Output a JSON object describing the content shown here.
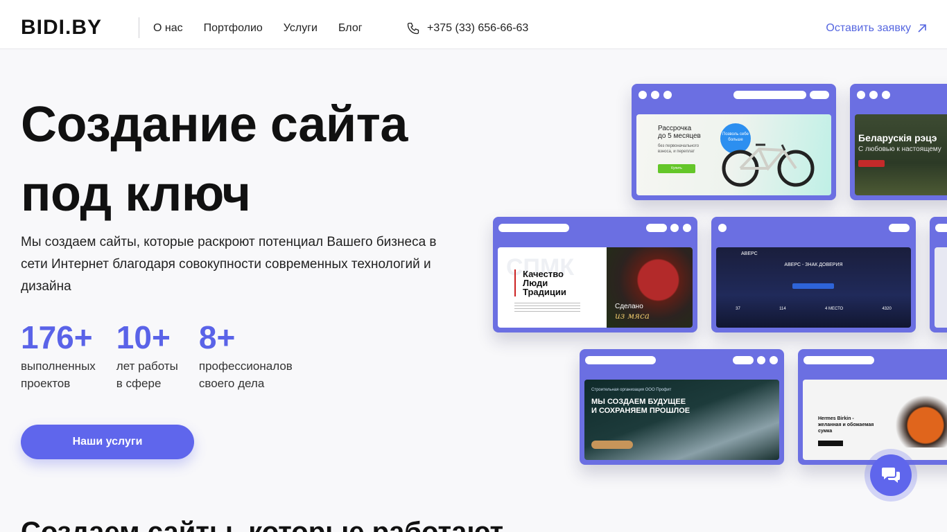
{
  "header": {
    "logo": "BIDI.BY",
    "nav": [
      {
        "label": "О нас"
      },
      {
        "label": "Портфолио"
      },
      {
        "label": "Услуги"
      },
      {
        "label": "Блог"
      }
    ],
    "phone": "+375 (33) 656-66-63",
    "cta": "Оставить заявку"
  },
  "hero": {
    "title_line1": "Создание сайта",
    "title_line2": "под ключ",
    "description": "Мы создаем сайты, которые раскроют потенциал Вашего бизнеса в сети Интернет благодаря совокупности современных технологий и дизайна",
    "stats": [
      {
        "value": "176+",
        "label_1": "выполненных",
        "label_2": "проектов"
      },
      {
        "value": "10+",
        "label_1": "лет работы",
        "label_2": "в сфере"
      },
      {
        "value": "8+",
        "label_1": "профессионалов",
        "label_2": "своего дела"
      }
    ],
    "button": "Наши услуги"
  },
  "portfolio": {
    "bike": {
      "line1": "Рассрочка",
      "line2": "до 5 месяцев",
      "sub": "без первоначального взноса, и переплат",
      "badge": "Позволь себе больше",
      "button": "Купить"
    },
    "belarus": {
      "title": "Беларускія рэцэ",
      "sub": "С любовью к настоящему"
    },
    "meat": {
      "watermark": "СПМК",
      "line1": "Качество",
      "line2": "Люди",
      "line3": "Традиции",
      "made": "Сделано",
      "script": "из мяса"
    },
    "avers": {
      "logo": "АВЕРС",
      "title": "АВЕРС - ЗНАК ДОВЕРИЯ",
      "stat1": "37",
      "stat2": "114",
      "stat3": "4 МЕСТО",
      "stat4": "4320"
    },
    "build": {
      "line1": "МЫ СОЗДАЕМ БУДУЩЕЕ",
      "line2": "И СОХРАНЯЕМ ПРОШЛОЕ",
      "small": "Строительная организация ООО Профит"
    },
    "birkin": {
      "line1": "Hermes Birkin -",
      "line2": "желанная и обожаемая",
      "line3": "сумка"
    }
  },
  "next_section": {
    "title": "Создаем сайты, которые работают"
  },
  "colors": {
    "accent": "#5f66ec",
    "stat": "#5a63e8",
    "window": "#6b6fe2",
    "link": "#5566e0"
  },
  "icons": [
    "phone-icon",
    "arrow-up-right-icon",
    "chat-icon"
  ]
}
